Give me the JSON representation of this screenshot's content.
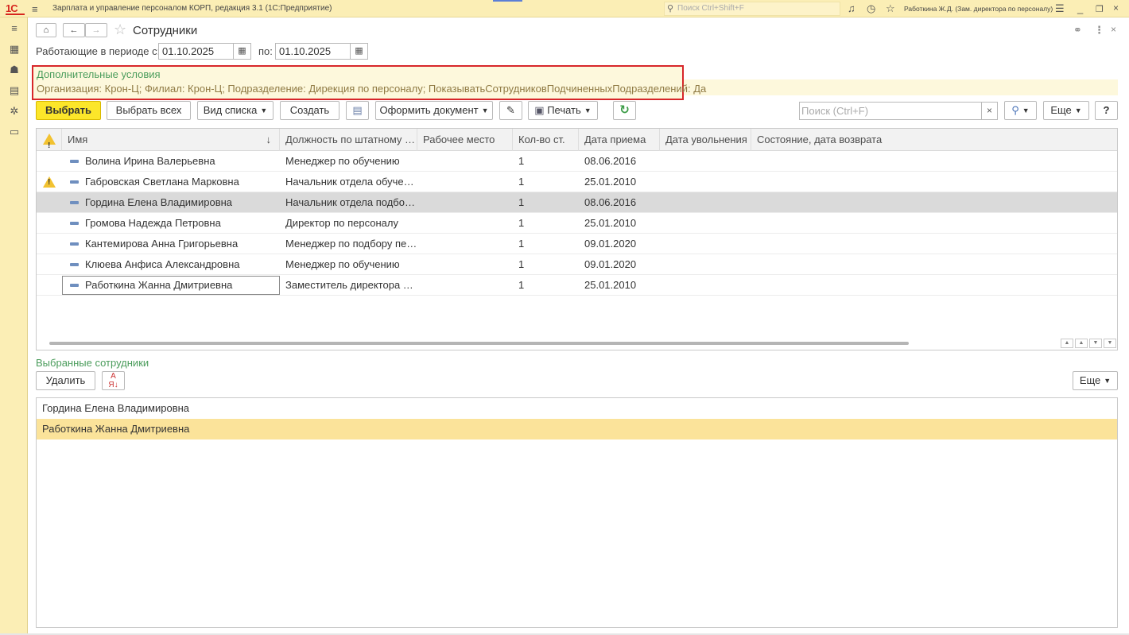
{
  "titlebar": {
    "logo": "1С",
    "app_title": "Зарплата и управление персоналом КОРП, редакция 3.1  (1С:Предприятие)",
    "search_placeholder": "Поиск Ctrl+Shift+F",
    "user": "Работкина Ж.Д. (Зам. директора по персоналу)"
  },
  "header": {
    "title": "Сотрудники"
  },
  "period": {
    "label_from": "Работающие в периоде с:",
    "from": "01.10.2025",
    "label_to": "по:",
    "to": "01.10.2025"
  },
  "additional_conditions": {
    "title": "Дополнительные условия",
    "text": "Организация: Крон-Ц; Филиал: Крон-Ц; Подразделение: Дирекция по персоналу; ПоказыватьСотрудниковПодчиненныхПодразделений: Да"
  },
  "toolbar": {
    "select": "Выбрать",
    "select_all": "Выбрать всех",
    "list_view": "Вид списка",
    "create": "Создать",
    "make_document": "Оформить документ",
    "print": "Печать",
    "search_placeholder": "Поиск (Ctrl+F)",
    "more": "Еще",
    "help": "?"
  },
  "table": {
    "columns": [
      "Имя",
      "Должность по штатному …",
      "Рабочее место",
      "Кол-во ст.",
      "Дата приема",
      "Дата увольнения",
      "Состояние, дата возврата"
    ],
    "rows": [
      {
        "warning": false,
        "name": "Волина Ирина Валерьевна",
        "position": "Менеджер по обучению",
        "workplace": "",
        "rate": "1",
        "hire_date": "08.06.2016",
        "dismiss_date": "",
        "state": ""
      },
      {
        "warning": true,
        "name": "Габровская Светлана Марковна",
        "position": "Начальник отдела обуче…",
        "workplace": "",
        "rate": "1",
        "hire_date": "25.01.2010",
        "dismiss_date": "",
        "state": ""
      },
      {
        "warning": false,
        "name": "Гордина Елена Владимировна",
        "position": "Начальник отдела подбо…",
        "workplace": "",
        "rate": "1",
        "hire_date": "08.06.2016",
        "dismiss_date": "",
        "state": ""
      },
      {
        "warning": false,
        "name": "Громова Надежда Петровна",
        "position": "Директор по персоналу",
        "workplace": "",
        "rate": "1",
        "hire_date": "25.01.2010",
        "dismiss_date": "",
        "state": ""
      },
      {
        "warning": false,
        "name": "Кантемирова Анна Григорьевна",
        "position": "Менеджер по подбору пе…",
        "workplace": "",
        "rate": "1",
        "hire_date": "09.01.2020",
        "dismiss_date": "",
        "state": ""
      },
      {
        "warning": false,
        "name": "Клюева Анфиса Александровна",
        "position": "Менеджер по обучению",
        "workplace": "",
        "rate": "1",
        "hire_date": "09.01.2020",
        "dismiss_date": "",
        "state": ""
      },
      {
        "warning": false,
        "name": "Работкина Жанна Дмитриевна",
        "position": "Заместитель директора …",
        "workplace": "",
        "rate": "1",
        "hire_date": "25.01.2010",
        "dismiss_date": "",
        "state": ""
      }
    ]
  },
  "selected": {
    "title": "Выбранные сотрудники",
    "delete": "Удалить",
    "more": "Еще",
    "items": [
      "Гордина Елена Владимировна",
      "Работкина Жанна Дмитриевна"
    ]
  },
  "colors": {
    "accent_yellow": "#fce62a",
    "title_bar": "#fbeeb5",
    "green_label": "#4a9c5b",
    "highlight_border": "#d7262a",
    "selected_item": "#fbe39a"
  }
}
